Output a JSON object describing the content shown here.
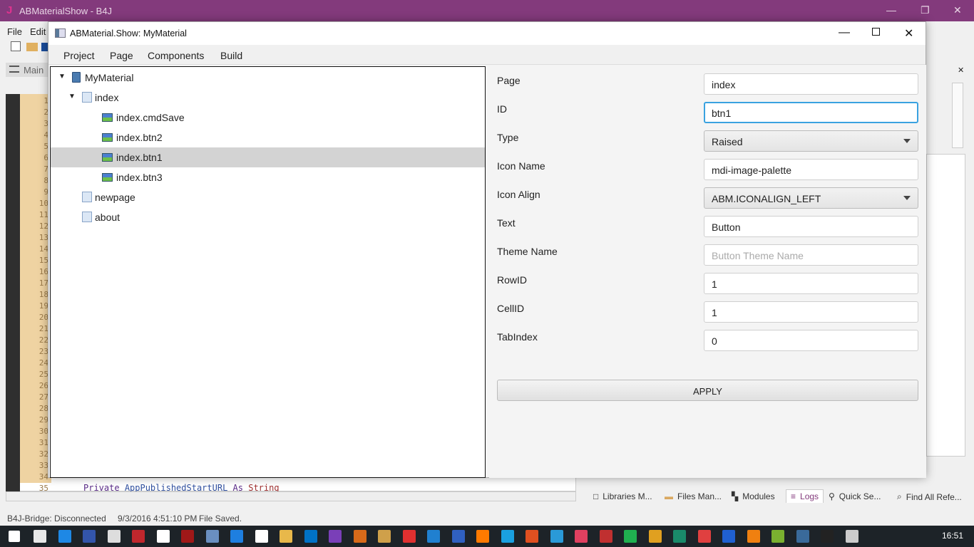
{
  "b4j": {
    "title": "ABMaterialShow - B4J",
    "menu": [
      "File",
      "Edit"
    ],
    "main_tab": "Main",
    "line_numbers": [
      "1",
      "2",
      "3",
      "4",
      "5",
      "6",
      "7",
      "8",
      "9",
      "10",
      "11",
      "12",
      "13",
      "14",
      "15",
      "16",
      "17",
      "18",
      "19",
      "20",
      "21",
      "22",
      "23",
      "24",
      "25",
      "26",
      "27",
      "28",
      "29",
      "30",
      "31",
      "32",
      "33",
      "34",
      "35"
    ],
    "code_line": {
      "kw": "Private",
      "name": "AppPublishedStartURL",
      "as": "As",
      "type": "String"
    },
    "bottom_tabs": [
      "Libraries M...",
      "Files Man...",
      "Modules",
      "Logs",
      "Quick Se...",
      "Find All Refe..."
    ],
    "active_tab": "Logs",
    "status": {
      "bridge": "B4J-Bridge: Disconnected",
      "time": "9/3/2016 4:51:10 PM",
      "msg": "File Saved."
    }
  },
  "dialog": {
    "title": "ABMaterial.Show: MyMaterial",
    "menu": [
      "Project",
      "Page",
      "Components",
      "Build"
    ],
    "tree": [
      {
        "label": "MyMaterial",
        "icon": "book-icon",
        "level": 0,
        "expanded": true
      },
      {
        "label": "index",
        "icon": "page-icon",
        "level": 1,
        "expanded": true
      },
      {
        "label": "index.cmdSave",
        "icon": "component-icon",
        "level": 2
      },
      {
        "label": "index.btn2",
        "icon": "component-icon",
        "level": 2
      },
      {
        "label": "index.btn1",
        "icon": "component-icon",
        "level": 2,
        "selected": true
      },
      {
        "label": "index.btn3",
        "icon": "component-icon",
        "level": 2
      },
      {
        "label": "newpage",
        "icon": "page-icon",
        "level": 1
      },
      {
        "label": "about",
        "icon": "page-icon",
        "level": 1
      }
    ],
    "form": [
      {
        "label": "Page",
        "value": "index",
        "kind": "text"
      },
      {
        "label": "ID",
        "value": "btn1",
        "kind": "focus"
      },
      {
        "label": "Type",
        "value": "Raised",
        "kind": "select"
      },
      {
        "label": "Icon Name",
        "value": "mdi-image-palette",
        "kind": "text"
      },
      {
        "label": "Icon Align",
        "value": "ABM.ICONALIGN_LEFT",
        "kind": "select"
      },
      {
        "label": "Text",
        "value": "Button",
        "kind": "text"
      },
      {
        "label": "Theme Name",
        "placeholder": "Button Theme Name",
        "kind": "placeholder"
      },
      {
        "label": "RowID",
        "value": "1",
        "kind": "text"
      },
      {
        "label": "CellID",
        "value": "1",
        "kind": "text"
      },
      {
        "label": "TabIndex",
        "value": "0",
        "kind": "text"
      }
    ],
    "apply_label": "APPLY"
  },
  "taskbar": {
    "clock": "16:51",
    "icons": [
      "#e8e8e8",
      "#1e88e5",
      "#3355aa",
      "#ddd",
      "#c0272d",
      "#fff",
      "#a01818",
      "#6a8fc0",
      "#1e7fe0",
      "#fff",
      "#e8b84a",
      "#0072c6",
      "#7a3fb8",
      "#d86a1a",
      "#cfa04a",
      "#e03030",
      "#2080d0",
      "#3060c0",
      "#ff7a00",
      "#1aa0e0",
      "#e05020",
      "#2a9ad8",
      "#e04060",
      "#c03030",
      "#20b050",
      "#e0a020",
      "#1a8a6a",
      "#e04040",
      "#2060d0",
      "#f08010",
      "#7ab030",
      "#3a6a9a",
      "#222",
      "#ccc"
    ]
  }
}
